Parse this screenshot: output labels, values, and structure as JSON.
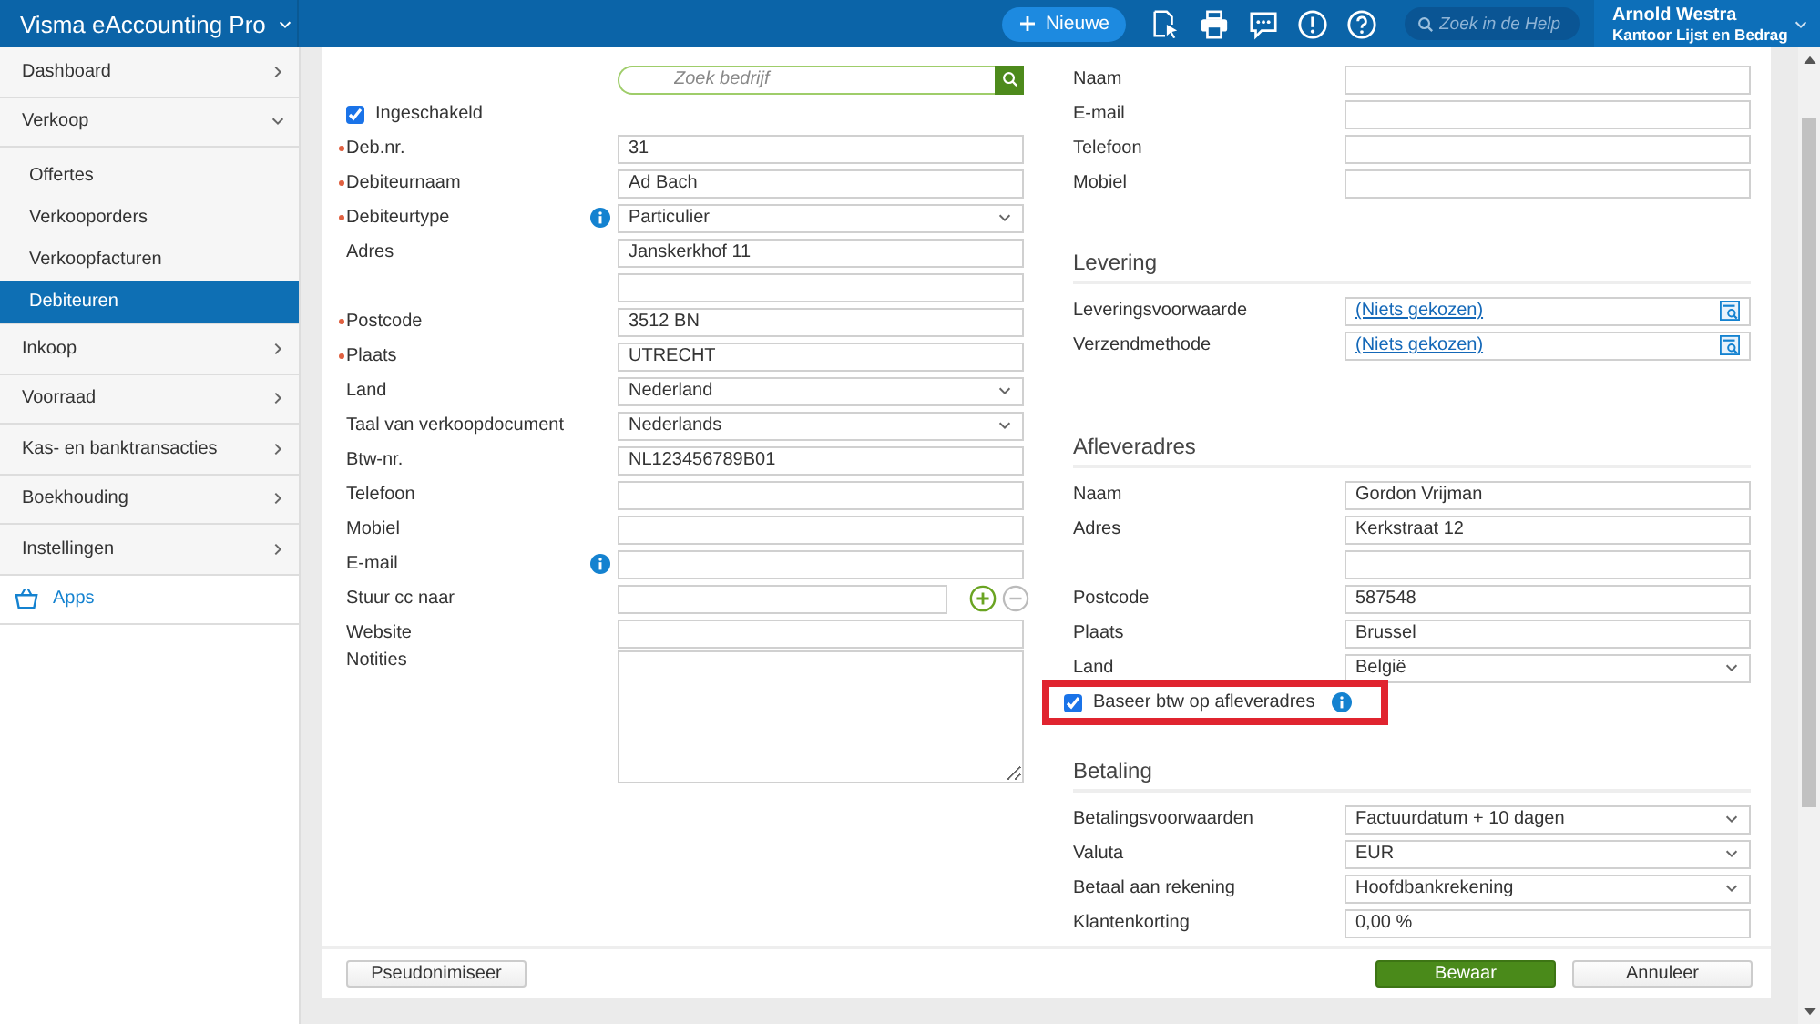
{
  "header": {
    "app_title": "Visma eAccounting Pro",
    "new_button": "Nieuwe",
    "help_search": {
      "placeholder": "Zoek in de Help"
    },
    "user": {
      "name": "Arnold Westra",
      "company": "Kantoor Lijst en Bedrag"
    }
  },
  "sidebar": {
    "items": [
      {
        "label": "Dashboard",
        "kind": "item",
        "expanded": false
      },
      {
        "label": "Verkoop",
        "kind": "item",
        "expanded": true,
        "children": [
          {
            "label": "Offertes",
            "selected": false
          },
          {
            "label": "Verkooporders",
            "selected": false
          },
          {
            "label": "Verkoopfacturen",
            "selected": false
          },
          {
            "label": "Debiteuren",
            "selected": true
          }
        ]
      },
      {
        "label": "Inkoop",
        "kind": "item",
        "expanded": false
      },
      {
        "label": "Voorraad",
        "kind": "item",
        "expanded": false
      },
      {
        "label": "Kas- en banktransacties",
        "kind": "item",
        "expanded": false
      },
      {
        "label": "Boekhouding",
        "kind": "item",
        "expanded": false
      },
      {
        "label": "Instellingen",
        "kind": "item",
        "expanded": false
      },
      {
        "label": "Apps",
        "kind": "apps"
      }
    ]
  },
  "left_form": {
    "search": {
      "placeholder": "Zoek bedrijf"
    },
    "enabled": {
      "label": "Ingeschakeld",
      "checked": true
    },
    "rows": [
      {
        "label": "Deb.nr.",
        "required": true,
        "kind": "text",
        "value": "31"
      },
      {
        "label": "Debiteurnaam",
        "required": true,
        "kind": "text",
        "value": "Ad Bach"
      },
      {
        "label": "Debiteurtype",
        "required": true,
        "info": true,
        "kind": "select",
        "value": "Particulier"
      },
      {
        "label": "Adres",
        "kind": "text",
        "value": "Janskerkhof 11"
      },
      {
        "kind": "text"
      },
      {
        "label": "Postcode",
        "required": true,
        "kind": "text",
        "value": "3512 BN"
      },
      {
        "label": "Plaats",
        "required": true,
        "kind": "text",
        "value": "UTRECHT"
      },
      {
        "label": "Land",
        "kind": "select",
        "value": "Nederland"
      },
      {
        "label": "Taal van verkoopdocument",
        "kind": "select",
        "value": "Nederlands"
      },
      {
        "label": "Btw-nr.",
        "kind": "text",
        "value": "NL123456789B01"
      },
      {
        "label": "Telefoon",
        "kind": "text"
      },
      {
        "label": "Mobiel",
        "kind": "text"
      },
      {
        "label": "E-mail",
        "info": true,
        "kind": "text"
      },
      {
        "label": "Stuur cc naar",
        "kind": "cc"
      },
      {
        "label": "Website",
        "kind": "text"
      },
      {
        "label": "Notities",
        "kind": "textarea"
      }
    ]
  },
  "right_form": {
    "sections": [
      {
        "rows": [
          {
            "label": "Naam",
            "kind": "text"
          },
          {
            "label": "E-mail",
            "kind": "text"
          },
          {
            "label": "Telefoon",
            "kind": "text"
          },
          {
            "label": "Mobiel",
            "kind": "text"
          }
        ]
      },
      {
        "title": "Levering",
        "rows": [
          {
            "label": "Leveringsvoorwaarde",
            "kind": "lookup",
            "value": "(Niets gekozen)"
          },
          {
            "label": "Verzendmethode",
            "kind": "lookup",
            "value": "(Niets gekozen)"
          }
        ]
      },
      {
        "title": "Afleveradres",
        "rows": [
          {
            "label": "Naam",
            "kind": "text",
            "value": "Gordon Vrijman"
          },
          {
            "label": "Adres",
            "kind": "text",
            "value": "Kerkstraat 12"
          },
          {
            "kind": "text"
          },
          {
            "label": "Postcode",
            "kind": "text",
            "value": "587548"
          },
          {
            "label": "Plaats",
            "kind": "text",
            "value": "Brussel"
          },
          {
            "label": "Land",
            "kind": "select",
            "value": "België"
          },
          {
            "label": "Baseer btw op afleveradres",
            "kind": "checkbox",
            "checked": true,
            "info": true,
            "highlighted": true
          }
        ]
      },
      {
        "title": "Betaling",
        "rows": [
          {
            "label": "Betalingsvoorwaarden",
            "kind": "select",
            "value": "Factuurdatum + 10 dagen"
          },
          {
            "label": "Valuta",
            "kind": "select",
            "value": "EUR"
          },
          {
            "label": "Betaal aan rekening",
            "kind": "select",
            "value": "Hoofdbankrekening"
          },
          {
            "label": "Klantenkorting",
            "kind": "text",
            "value": "0,00 %"
          }
        ]
      }
    ]
  },
  "footer": {
    "buttons": [
      {
        "label": "Pseudonimiseer",
        "kind": "secondary"
      },
      {
        "label": "Bewaar",
        "kind": "primary"
      },
      {
        "label": "Annuleer",
        "kind": "secondary"
      }
    ]
  }
}
